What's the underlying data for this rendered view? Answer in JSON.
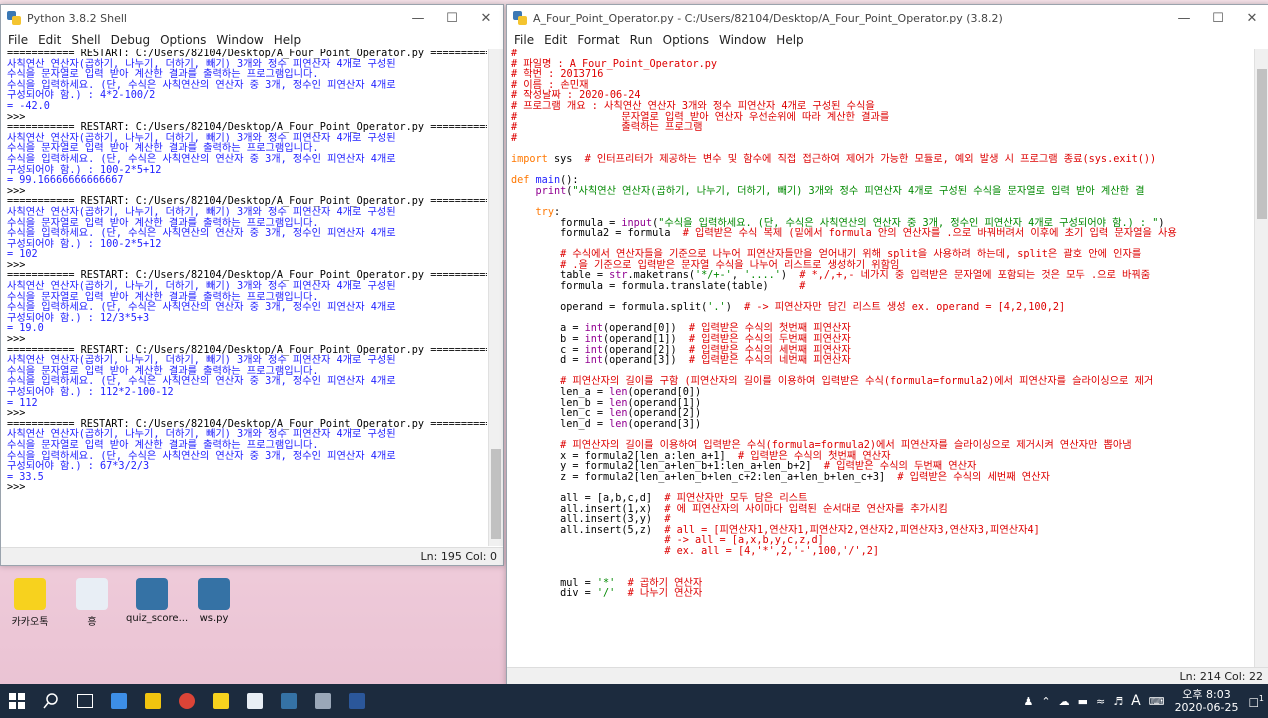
{
  "shell": {
    "title": "Python 3.8.2 Shell",
    "menu": [
      "File",
      "Edit",
      "Shell",
      "Debug",
      "Options",
      "Window",
      "Help"
    ],
    "status": "Ln: 195  Col: 0",
    "lines": [
      {
        "t": "=========== RESTART: C:/Users/82104/Desktop/A_Four_Point_Operator.py ===========",
        "c": "black"
      },
      {
        "t": "사칙연산 연산자(곱하기, 나누기, 더하기, 빼기) 3개와 정수 피연산자 4개로 구성된",
        "c": "blue"
      },
      {
        "t": "수식을 문자열로 입력 받아 계산한 결과를 출력하는 프로그램입니다.",
        "c": "blue"
      },
      {
        "t": "수식을 입력하세요. (단, 수식은 사칙연산의 연산자 중 3개, 정수인 피연산자 4개로",
        "c": "blue"
      },
      {
        "t": "구성되어야 함.) : 4*2-100/2",
        "c": "blue"
      },
      {
        "t": "= -42.0",
        "c": "blue"
      },
      {
        "t": ">>>",
        "c": "black"
      },
      {
        "t": "=========== RESTART: C:/Users/82104/Desktop/A_Four_Point_Operator.py ===========",
        "c": "black"
      },
      {
        "t": "사칙연산 연산자(곱하기, 나누기, 더하기, 빼기) 3개와 정수 피연산자 4개로 구성된",
        "c": "blue"
      },
      {
        "t": "수식을 문자열로 입력 받아 계산한 결과를 출력하는 프로그램입니다.",
        "c": "blue"
      },
      {
        "t": "수식을 입력하세요. (단, 수식은 사칙연산의 연산자 중 3개, 정수인 피연산자 4개로",
        "c": "blue"
      },
      {
        "t": "구성되어야 함.) : 100-2*5+12",
        "c": "blue"
      },
      {
        "t": "= 99.16666666666667",
        "c": "blue"
      },
      {
        "t": ">>>",
        "c": "black"
      },
      {
        "t": "=========== RESTART: C:/Users/82104/Desktop/A_Four_Point_Operator.py ===========",
        "c": "black"
      },
      {
        "t": "사칙연산 연산자(곱하기, 나누기, 더하기, 빼기) 3개와 정수 피연산자 4개로 구성된",
        "c": "blue"
      },
      {
        "t": "수식을 문자열로 입력 받아 계산한 결과를 출력하는 프로그램입니다.",
        "c": "blue"
      },
      {
        "t": "수식을 입력하세요. (단, 수식은 사칙연산의 연산자 중 3개, 정수인 피연산자 4개로",
        "c": "blue"
      },
      {
        "t": "구성되어야 함.) : 100-2*5+12",
        "c": "blue"
      },
      {
        "t": "= 102",
        "c": "blue"
      },
      {
        "t": ">>>",
        "c": "black"
      },
      {
        "t": "=========== RESTART: C:/Users/82104/Desktop/A_Four_Point_Operator.py ===========",
        "c": "black"
      },
      {
        "t": "사칙연산 연산자(곱하기, 나누기, 더하기, 빼기) 3개와 정수 피연산자 4개로 구성된",
        "c": "blue"
      },
      {
        "t": "수식을 문자열로 입력 받아 계산한 결과를 출력하는 프로그램입니다.",
        "c": "blue"
      },
      {
        "t": "수식을 입력하세요. (단, 수식은 사칙연산의 연산자 중 3개, 정수인 피연산자 4개로",
        "c": "blue"
      },
      {
        "t": "구성되어야 함.) : 12/3*5+3",
        "c": "blue"
      },
      {
        "t": "= 19.0",
        "c": "blue"
      },
      {
        "t": ">>>",
        "c": "black"
      },
      {
        "t": "=========== RESTART: C:/Users/82104/Desktop/A_Four_Point_Operator.py ===========",
        "c": "black"
      },
      {
        "t": "사칙연산 연산자(곱하기, 나누기, 더하기, 빼기) 3개와 정수 피연산자 4개로 구성된",
        "c": "blue"
      },
      {
        "t": "수식을 문자열로 입력 받아 계산한 결과를 출력하는 프로그램입니다.",
        "c": "blue"
      },
      {
        "t": "수식을 입력하세요. (단, 수식은 사칙연산의 연산자 중 3개, 정수인 피연산자 4개로",
        "c": "blue"
      },
      {
        "t": "구성되어야 함.) : 112*2-100-12",
        "c": "blue"
      },
      {
        "t": "= 112",
        "c": "blue"
      },
      {
        "t": ">>>",
        "c": "black"
      },
      {
        "t": "=========== RESTART: C:/Users/82104/Desktop/A_Four_Point_Operator.py ===========",
        "c": "black"
      },
      {
        "t": "사칙연산 연산자(곱하기, 나누기, 더하기, 빼기) 3개와 정수 피연산자 4개로 구성된",
        "c": "blue"
      },
      {
        "t": "수식을 문자열로 입력 받아 계산한 결과를 출력하는 프로그램입니다.",
        "c": "blue"
      },
      {
        "t": "수식을 입력하세요. (단, 수식은 사칙연산의 연산자 중 3개, 정수인 피연산자 4개로",
        "c": "blue"
      },
      {
        "t": "구성되어야 함.) : 67*3/2/3",
        "c": "blue"
      },
      {
        "t": "= 33.5",
        "c": "blue"
      },
      {
        "t": ">>>",
        "c": "black"
      }
    ]
  },
  "editor": {
    "title": "A_Four_Point_Operator.py - C:/Users/82104/Desktop/A_Four_Point_Operator.py (3.8.2)",
    "menu": [
      "File",
      "Edit",
      "Format",
      "Run",
      "Options",
      "Window",
      "Help"
    ],
    "status": "Ln: 214  Col: 22",
    "lines": [
      [
        {
          "t": "#",
          "c": "red"
        }
      ],
      [
        {
          "t": "# 파일명 : A_Four_Point_Operator.py",
          "c": "red"
        }
      ],
      [
        {
          "t": "# 학번 : 2013716",
          "c": "red"
        }
      ],
      [
        {
          "t": "# 이름 : 손민재",
          "c": "red"
        }
      ],
      [
        {
          "t": "# 작성날짜 : 2020-06-24",
          "c": "red"
        }
      ],
      [
        {
          "t": "# 프로그램 개요 : 사칙연산 연산자 3개와 정수 피연산자 4개로 구성된 수식을",
          "c": "red"
        }
      ],
      [
        {
          "t": "#                 문자열로 입력 받아 연산자 우선순위에 따라 계산한 결과를",
          "c": "red"
        }
      ],
      [
        {
          "t": "#                 출력하는 프로그램",
          "c": "red"
        }
      ],
      [
        {
          "t": "#",
          "c": "red"
        }
      ],
      [
        {
          "t": "",
          "c": "black"
        }
      ],
      [
        {
          "t": "import",
          "c": "orange"
        },
        {
          "t": " sys  ",
          "c": "black"
        },
        {
          "t": "# 인터프리터가 제공하는 변수 및 함수에 직접 접근하여 제어가 가능한 모듈로, 예외 발생 시 프로그램 종료(sys.exit())",
          "c": "red"
        }
      ],
      [
        {
          "t": "",
          "c": "black"
        }
      ],
      [
        {
          "t": "def",
          "c": "orange"
        },
        {
          "t": " main",
          "c": "blue"
        },
        {
          "t": "():",
          "c": "black"
        }
      ],
      [
        {
          "t": "    ",
          "c": "black"
        },
        {
          "t": "print",
          "c": "purple"
        },
        {
          "t": "(",
          "c": "black"
        },
        {
          "t": "\"사칙연산 연산자(곱하기, 나누기, 더하기, 빼기) 3개와 정수 피연산자 4개로 구성된 수식을 문자열로 입력 받아 계산한 결",
          "c": "green"
        }
      ],
      [
        {
          "t": "",
          "c": "black"
        }
      ],
      [
        {
          "t": "    ",
          "c": "black"
        },
        {
          "t": "try",
          "c": "orange"
        },
        {
          "t": ":",
          "c": "black"
        }
      ],
      [
        {
          "t": "        formula = ",
          "c": "black"
        },
        {
          "t": "input",
          "c": "purple"
        },
        {
          "t": "(",
          "c": "black"
        },
        {
          "t": "\"수식을 입력하세요. (단, 수식은 사칙연산의 연산자 중 3개, 정수인 피연산자 4개로 구성되어야 함.) : \"",
          "c": "green"
        },
        {
          "t": ")",
          "c": "black"
        }
      ],
      [
        {
          "t": "        formula2 = formula  ",
          "c": "black"
        },
        {
          "t": "# 입력받은 수식 복제 (밑에서 formula 안의 연산자를 .으로 바꿔버려서 이후에 초기 입력 문자열을 사용",
          "c": "red"
        }
      ],
      [
        {
          "t": "",
          "c": "black"
        }
      ],
      [
        {
          "t": "        ",
          "c": "black"
        },
        {
          "t": "# 수식에서 연산자들을 기준으로 나누어 피연산자들만을 얻어내기 위해 split을 사용하려 하는데, split은 괄호 안에 인자를",
          "c": "red"
        }
      ],
      [
        {
          "t": "        ",
          "c": "black"
        },
        {
          "t": "# .을 기준으로 입력받은 문자열 수식을 나누어 리스트로 생성하기 위함임",
          "c": "red"
        }
      ],
      [
        {
          "t": "        table = ",
          "c": "black"
        },
        {
          "t": "str",
          "c": "purple"
        },
        {
          "t": ".maketrans(",
          "c": "black"
        },
        {
          "t": "'*/+-'",
          "c": "green"
        },
        {
          "t": ", ",
          "c": "black"
        },
        {
          "t": "'....'",
          "c": "green"
        },
        {
          "t": ")  ",
          "c": "black"
        },
        {
          "t": "# *,/,+,- 네가지 중 입력받은 문자열에 포함되는 것은 모두 .으로 바꿔줌",
          "c": "red"
        }
      ],
      [
        {
          "t": "        formula = formula.translate(table)     ",
          "c": "black"
        },
        {
          "t": "#",
          "c": "red"
        }
      ],
      [
        {
          "t": "",
          "c": "black"
        }
      ],
      [
        {
          "t": "        operand = formula.split(",
          "c": "black"
        },
        {
          "t": "'.'",
          "c": "green"
        },
        {
          "t": ")  ",
          "c": "black"
        },
        {
          "t": "# -> 피연산자만 담긴 리스트 생성 ex. operand = [4,2,100,2]",
          "c": "red"
        }
      ],
      [
        {
          "t": "",
          "c": "black"
        }
      ],
      [
        {
          "t": "        a = ",
          "c": "black"
        },
        {
          "t": "int",
          "c": "purple"
        },
        {
          "t": "(operand[0])  ",
          "c": "black"
        },
        {
          "t": "# 입력받은 수식의 첫번째 피연산자",
          "c": "red"
        }
      ],
      [
        {
          "t": "        b = ",
          "c": "black"
        },
        {
          "t": "int",
          "c": "purple"
        },
        {
          "t": "(operand[1])  ",
          "c": "black"
        },
        {
          "t": "# 입력받은 수식의 두번째 피연산자",
          "c": "red"
        }
      ],
      [
        {
          "t": "        c = ",
          "c": "black"
        },
        {
          "t": "int",
          "c": "purple"
        },
        {
          "t": "(operand[2])  ",
          "c": "black"
        },
        {
          "t": "# 입력받은 수식의 세번째 피연산자",
          "c": "red"
        }
      ],
      [
        {
          "t": "        d = ",
          "c": "black"
        },
        {
          "t": "int",
          "c": "purple"
        },
        {
          "t": "(operand[3])  ",
          "c": "black"
        },
        {
          "t": "# 입력받은 수식의 네번째 피연산자",
          "c": "red"
        }
      ],
      [
        {
          "t": "",
          "c": "black"
        }
      ],
      [
        {
          "t": "        ",
          "c": "black"
        },
        {
          "t": "# 피연산자의 길이를 구함 (피연산자의 길이를 이용하여 입력받은 수식(formula=formula2)에서 피연산자를 슬라이싱으로 제거",
          "c": "red"
        }
      ],
      [
        {
          "t": "        len_a = ",
          "c": "black"
        },
        {
          "t": "len",
          "c": "purple"
        },
        {
          "t": "(operand[0])",
          "c": "black"
        }
      ],
      [
        {
          "t": "        len_b = ",
          "c": "black"
        },
        {
          "t": "len",
          "c": "purple"
        },
        {
          "t": "(operand[1])",
          "c": "black"
        }
      ],
      [
        {
          "t": "        len_c = ",
          "c": "black"
        },
        {
          "t": "len",
          "c": "purple"
        },
        {
          "t": "(operand[2])",
          "c": "black"
        }
      ],
      [
        {
          "t": "        len_d = ",
          "c": "black"
        },
        {
          "t": "len",
          "c": "purple"
        },
        {
          "t": "(operand[3])",
          "c": "black"
        }
      ],
      [
        {
          "t": "",
          "c": "black"
        }
      ],
      [
        {
          "t": "        ",
          "c": "black"
        },
        {
          "t": "# 피연산자의 길이를 이용하여 입력받은 수식(formula=formula2)에서 피연산자를 슬라이싱으로 제거시켜 연산자만 뽑아냄",
          "c": "red"
        }
      ],
      [
        {
          "t": "        x = formula2[len_a:len_a+1]  ",
          "c": "black"
        },
        {
          "t": "# 입력받은 수식의 첫번째 연산자",
          "c": "red"
        }
      ],
      [
        {
          "t": "        y = formula2[len_a+len_b+1:len_a+len_b+2]  ",
          "c": "black"
        },
        {
          "t": "# 입력받은 수식의 두번째 연산자",
          "c": "red"
        }
      ],
      [
        {
          "t": "        z = formula2[len_a+len_b+len_c+2:len_a+len_b+len_c+3]  ",
          "c": "black"
        },
        {
          "t": "# 입력받은 수식의 세번째 연산자",
          "c": "red"
        }
      ],
      [
        {
          "t": "",
          "c": "black"
        }
      ],
      [
        {
          "t": "        all = [a,b,c,d]  ",
          "c": "black"
        },
        {
          "t": "# 피연산자만 모두 담은 리스트",
          "c": "red"
        }
      ],
      [
        {
          "t": "        all.insert(1,x)  ",
          "c": "black"
        },
        {
          "t": "# 에 피연산자의 사이마다 입력된 순서대로 연산자를 추가시킴",
          "c": "red"
        }
      ],
      [
        {
          "t": "        all.insert(3,y)  ",
          "c": "black"
        },
        {
          "t": "#",
          "c": "red"
        }
      ],
      [
        {
          "t": "        all.insert(5,z)  ",
          "c": "black"
        },
        {
          "t": "# all = [피연산자1,연산자1,피연산자2,연산자2,피연산자3,연산자3,피연산자4]",
          "c": "red"
        }
      ],
      [
        {
          "t": "                         ",
          "c": "black"
        },
        {
          "t": "# -> all = [a,x,b,y,c,z,d]",
          "c": "red"
        }
      ],
      [
        {
          "t": "                         ",
          "c": "black"
        },
        {
          "t": "# ex. all = [4,'*',2,'-',100,'/',2]",
          "c": "red"
        }
      ],
      [
        {
          "t": "",
          "c": "black"
        }
      ],
      [
        {
          "t": "",
          "c": "black"
        }
      ],
      [
        {
          "t": "        mul = ",
          "c": "black"
        },
        {
          "t": "'*'",
          "c": "green"
        },
        {
          "t": "  ",
          "c": "black"
        },
        {
          "t": "# 곱하기 연산자",
          "c": "red"
        }
      ],
      [
        {
          "t": "        div = ",
          "c": "black"
        },
        {
          "t": "'/'",
          "c": "green"
        },
        {
          "t": "  ",
          "c": "black"
        },
        {
          "t": "# 나누기 연산자",
          "c": "red"
        }
      ]
    ]
  },
  "desktop": {
    "icons": [
      {
        "label": "카카오톡",
        "color": "#f7d21e",
        "name": "kakaotalk-icon"
      },
      {
        "label": "흥",
        "color": "#e8eef5",
        "name": "file-icon"
      },
      {
        "label": "quiz_score...",
        "color": "#3572a5",
        "name": "python-file-icon"
      },
      {
        "label": "ws.py",
        "color": "#3572a5",
        "name": "python-file-icon"
      }
    ]
  },
  "taskbar": {
    "clock_time": "오후 8:03",
    "clock_date": "2020-06-25",
    "ime": "A",
    "notification_count": "1"
  }
}
